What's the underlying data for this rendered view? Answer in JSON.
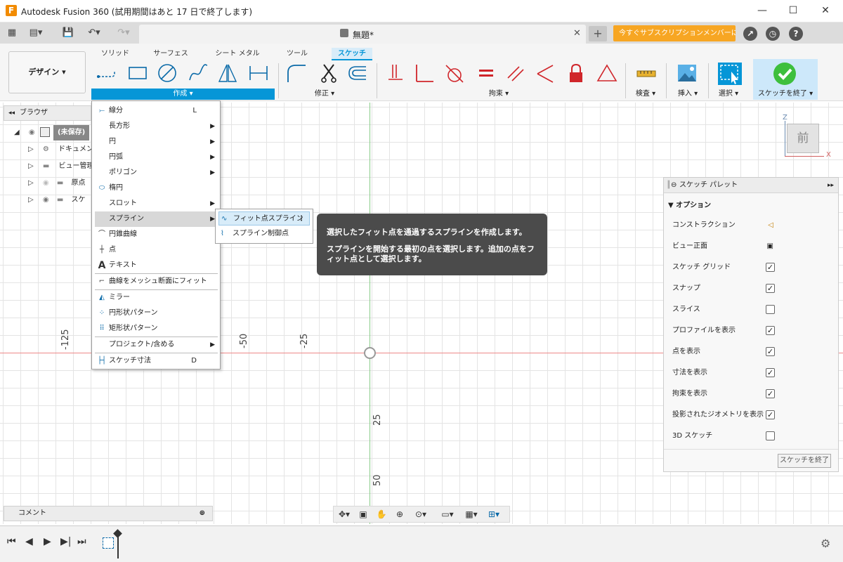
{
  "window": {
    "title": "Autodesk Fusion 360 (試用期間はあと 17 日で終了します)",
    "minimize": "—",
    "maximize": "☐",
    "close": "✕"
  },
  "tabbar": {
    "doc_name": "無題*",
    "close_glyph": "✕",
    "plus_glyph": "+",
    "upgrade": "今すぐサブスクリプションメンバーに..."
  },
  "ribbon": {
    "design": "デザイン ▾",
    "tabs": [
      "ソリッド",
      "サーフェス",
      "シート メタル",
      "ツール",
      "スケッチ"
    ],
    "groups": {
      "create": "作成 ▾",
      "modify": "修正 ▾",
      "constraints": "拘束 ▾",
      "inspect": "検査 ▾",
      "insert": "挿入 ▾",
      "select": "選択 ▾",
      "finish": "スケッチを終了 ▾"
    }
  },
  "browser": {
    "title": "ブラウザ",
    "items": [
      "(未保存)",
      "ドキュメン",
      "ビュー管理",
      "原点",
      "スケ"
    ]
  },
  "create_menu": {
    "items": [
      {
        "label": "線分",
        "shortcut": "L"
      },
      {
        "label": "長方形"
      },
      {
        "label": "円"
      },
      {
        "label": "円弧"
      },
      {
        "label": "ポリゴン"
      },
      {
        "label": "楕円"
      },
      {
        "label": "スロット"
      },
      {
        "label": "スプライン"
      },
      {
        "label": "円錐曲線"
      },
      {
        "label": "点"
      },
      {
        "label": "テキスト"
      },
      {
        "label": "曲線をメッシュ断面にフィット"
      },
      {
        "label": "ミラー"
      },
      {
        "label": "円形状パターン"
      },
      {
        "label": "矩形状パターン"
      },
      {
        "label": "プロジェクト/含める"
      },
      {
        "label": "スケッチ寸法",
        "shortcut": "D"
      }
    ],
    "submenu": [
      "フィット点スプライン",
      "スプライン制御点"
    ]
  },
  "tooltip": {
    "line1": "選択したフィット点を通過するスプラインを作成します。",
    "line2": "スプラインを開始する最初の点を選択します。追加の点をフィット点として選択します。"
  },
  "canvas": {
    "labels": [
      "-125",
      "-50",
      "-25",
      "25",
      "50"
    ],
    "viewcube_face": "前",
    "axis_z": "Z",
    "axis_x": "X"
  },
  "palette": {
    "title": "スケッチ パレット",
    "section": "オプション",
    "rows": [
      {
        "label": "コンストラクション",
        "kind": "icon"
      },
      {
        "label": "ビュー正面",
        "kind": "icon"
      },
      {
        "label": "スケッチ グリッド",
        "checked": true
      },
      {
        "label": "スナップ",
        "checked": true
      },
      {
        "label": "スライス",
        "checked": false
      },
      {
        "label": "プロファイルを表示",
        "checked": true
      },
      {
        "label": "点を表示",
        "checked": true
      },
      {
        "label": "寸法を表示",
        "checked": true
      },
      {
        "label": "拘束を表示",
        "checked": true
      },
      {
        "label": "投影されたジオメトリを表示",
        "checked": true
      },
      {
        "label": "3D スケッチ",
        "checked": false
      }
    ],
    "finish": "スケッチを終了",
    "check_glyph": "✓"
  },
  "comment": {
    "label": "コメント"
  },
  "colors": {
    "accent": "#0696d7",
    "upgrade": "#f7a623",
    "finish_green": "#3dbf3d",
    "constraint_red": "#d0262b"
  }
}
